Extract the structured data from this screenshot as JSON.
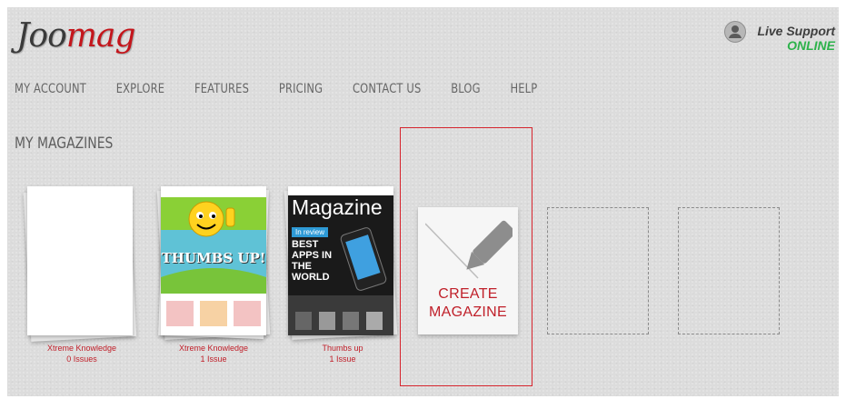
{
  "brand": {
    "logo_part1": "Joo",
    "logo_part2": "mag"
  },
  "support": {
    "label": "Live Support",
    "status": "ONLINE",
    "icon": "user-icon"
  },
  "nav": [
    "MY ACCOUNT",
    "EXPLORE",
    "FEATURES",
    "PRICING",
    "CONTACT US",
    "BLOG",
    "HELP"
  ],
  "section_title": "MY MAGAZINES",
  "magazines": [
    {
      "title": "Xtreme Knowledge",
      "issues": "0 Issues"
    },
    {
      "title": "Xtreme Knowledge",
      "issues": "1 Issue"
    },
    {
      "title": "Thumbs up",
      "issues": "1 Issue"
    }
  ],
  "cover_texts": {
    "thumbs": "THUMBS UP!",
    "magazine_title": "Magazine",
    "review": "In review",
    "headline": "BEST APPS IN THE WORLD"
  },
  "create": {
    "label_line1": "CREATE",
    "label_line2": "MAGAZINE",
    "icon": "pencil-icon"
  },
  "colors": {
    "accent": "#c0202a",
    "online": "#2cb24a",
    "background": "#dcdcdc"
  }
}
